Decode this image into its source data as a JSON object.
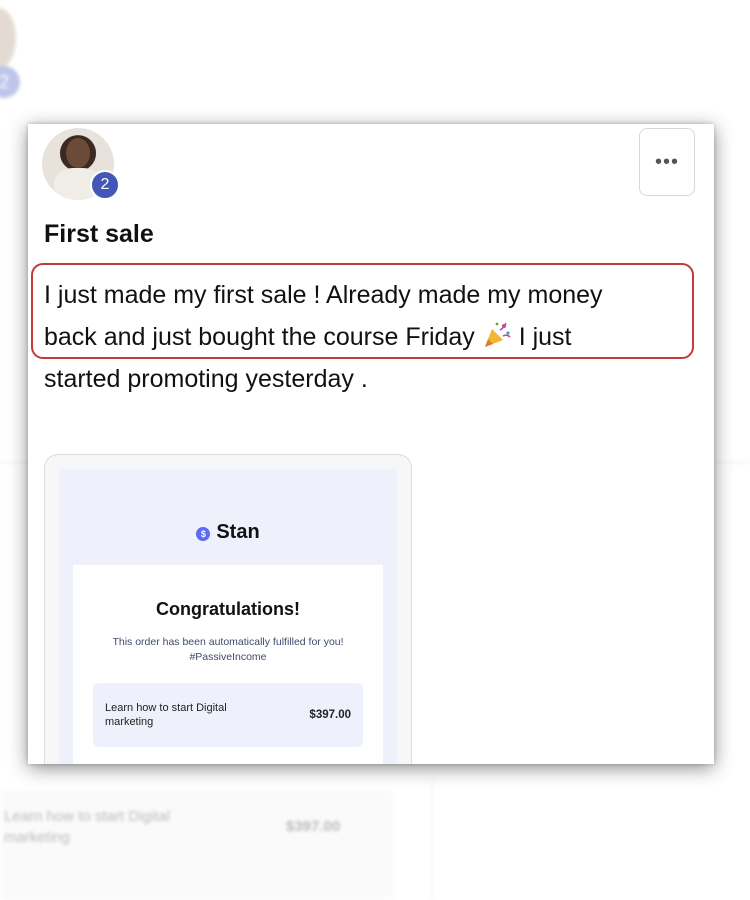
{
  "background": {
    "badge": "2",
    "item_label": "Learn how to start Digital marketing",
    "item_price": "$397.00"
  },
  "post": {
    "level_badge": "2",
    "more_label": "•••",
    "title": "First sale",
    "body_line1": "I just made my first sale ! Already made my money",
    "body_line2a": "back and just bought the course Friday ",
    "body_line2b": " I just",
    "body_line3": "started promoting yesterday .",
    "emoji_icon": "party-popper-icon",
    "highlight_color": "#c23a3a"
  },
  "attachment": {
    "brand": "Stan",
    "heading": "Congratulations!",
    "subtext_line1": "This order has been automatically fulfilled for you!",
    "subtext_line2": "#PassiveIncome",
    "order_label": "Learn how to start Digital marketing",
    "order_price": "$397.00",
    "brand_color": "#5a6cf0"
  }
}
